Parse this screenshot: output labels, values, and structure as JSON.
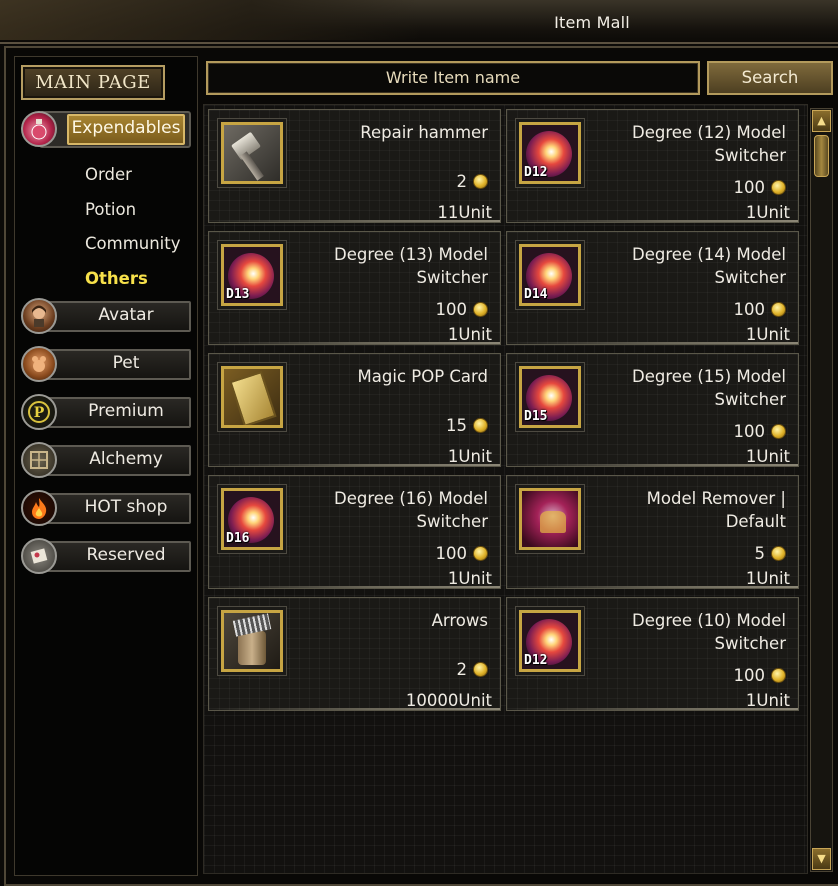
{
  "window": {
    "title": "Item Mall"
  },
  "sidebar": {
    "main_page_label": "MAIN PAGE",
    "categories": [
      {
        "label": "Expendables",
        "icon": "potion-icon",
        "active": true
      },
      {
        "label": "Avatar",
        "icon": "avatar-icon"
      },
      {
        "label": "Pet",
        "icon": "pet-icon"
      },
      {
        "label": "Premium",
        "icon": "premium-icon"
      },
      {
        "label": "Alchemy",
        "icon": "alchemy-icon"
      },
      {
        "label": "HOT shop",
        "icon": "fire-icon"
      },
      {
        "label": "Reserved",
        "icon": "reserved-icon"
      }
    ],
    "subcategories": [
      {
        "label": "Order"
      },
      {
        "label": "Potion"
      },
      {
        "label": "Community"
      },
      {
        "label": "Others",
        "selected": true
      }
    ]
  },
  "search": {
    "placeholder": "Write Item name",
    "button_label": "Search"
  },
  "items": [
    {
      "name": "Repair hammer",
      "price": "2",
      "unit": "11Unit",
      "icon": "repair-hammer-icon",
      "badge": ""
    },
    {
      "name": "Degree (12) Model Switcher",
      "price": "100",
      "unit": "1Unit",
      "icon": "model-switcher-icon",
      "badge": "D12"
    },
    {
      "name": "Degree (13) Model Switcher",
      "price": "100",
      "unit": "1Unit",
      "icon": "model-switcher-icon",
      "badge": "D13"
    },
    {
      "name": "Degree (14) Model Switcher",
      "price": "100",
      "unit": "1Unit",
      "icon": "model-switcher-icon",
      "badge": "D14"
    },
    {
      "name": "Magic POP Card",
      "price": "15",
      "unit": "1Unit",
      "icon": "magic-pop-card-icon",
      "badge": ""
    },
    {
      "name": "Degree (15) Model Switcher",
      "price": "100",
      "unit": "1Unit",
      "icon": "model-switcher-icon",
      "badge": "D15"
    },
    {
      "name": "Degree (16) Model Switcher",
      "price": "100",
      "unit": "1Unit",
      "icon": "model-switcher-icon",
      "badge": "D16"
    },
    {
      "name": "Model Remover | Default",
      "price": "5",
      "unit": "1Unit",
      "icon": "model-remover-icon",
      "badge": ""
    },
    {
      "name": "Arrows",
      "price": "2",
      "unit": "10000Unit",
      "icon": "arrows-icon",
      "badge": ""
    },
    {
      "name": "Degree (10) Model Switcher",
      "price": "100",
      "unit": "1Unit",
      "icon": "model-switcher-icon",
      "badge": "D12"
    }
  ],
  "colors": {
    "accent_gold": "#b39a5c",
    "selected_text": "#f7e14a",
    "active_tab": "#a88431"
  },
  "scrollbar": {
    "up_icon": "scroll-up-icon",
    "down_icon": "scroll-down-icon"
  }
}
